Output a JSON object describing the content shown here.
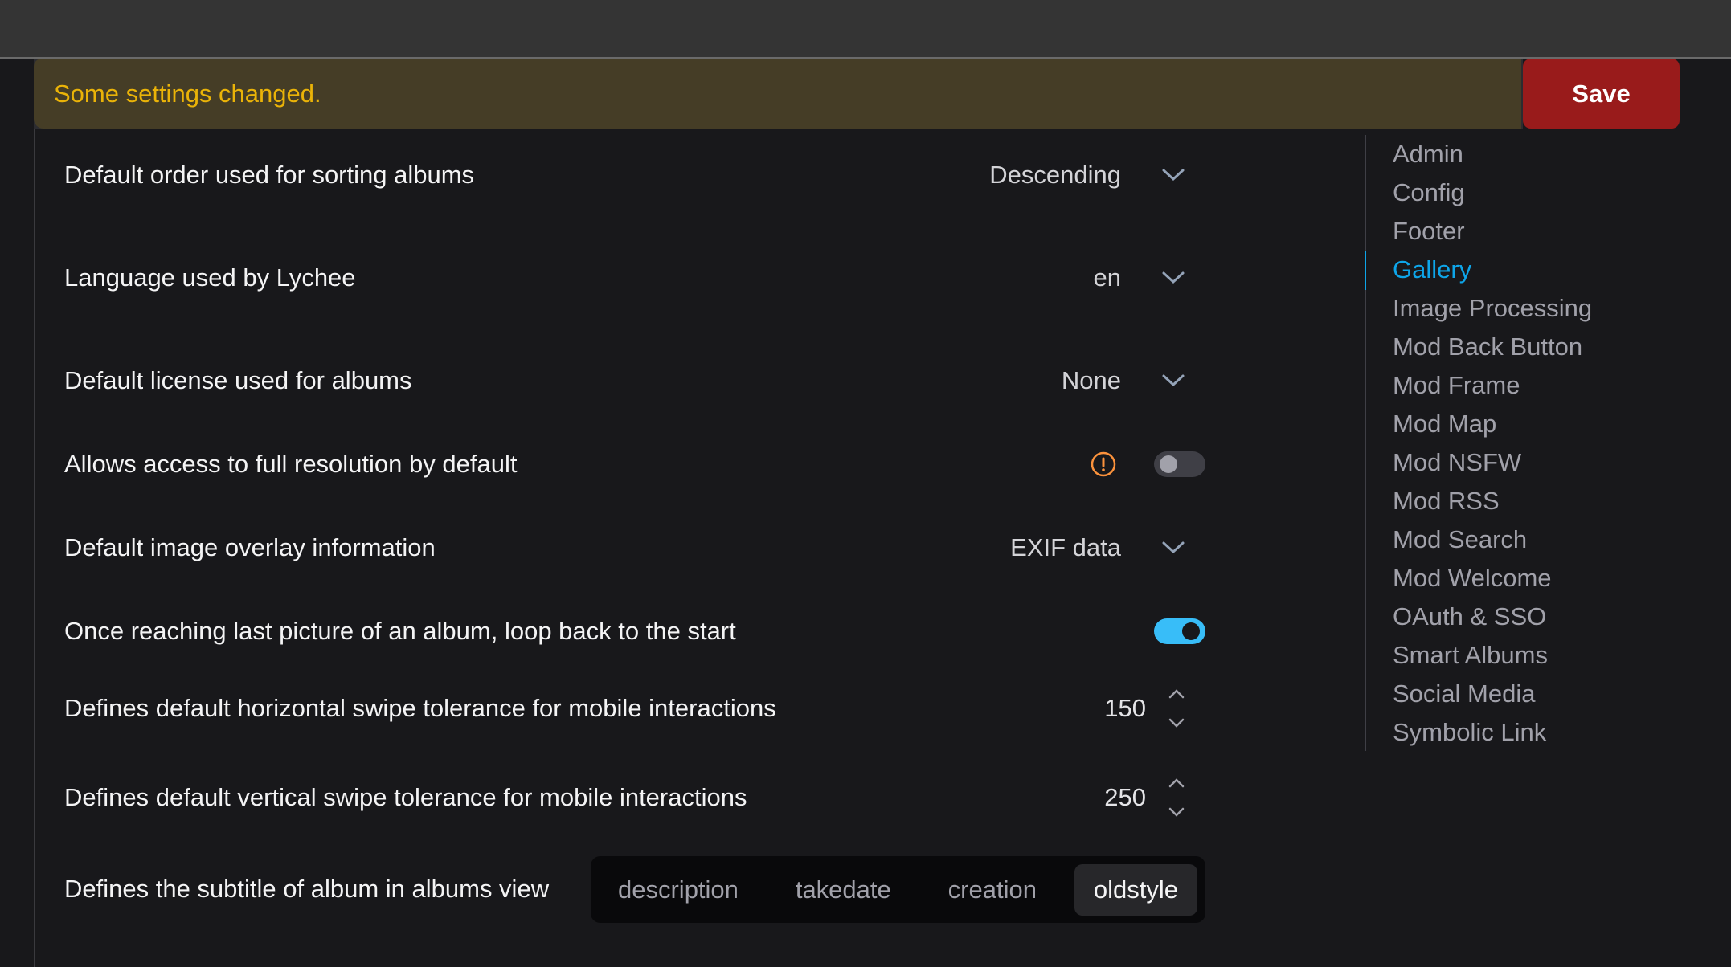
{
  "banner": {
    "message": "Some settings changed.",
    "save_label": "Save"
  },
  "settings": [
    {
      "label": "Default order used for sorting albums",
      "type": "select",
      "value": "Descending"
    },
    {
      "label": "Language used by Lychee",
      "type": "select",
      "value": "en"
    },
    {
      "label": "Default license used for albums",
      "type": "select",
      "value": "None"
    },
    {
      "label": "Allows access to full resolution by default",
      "type": "toggle",
      "value": false,
      "warning": true
    },
    {
      "label": "Default image overlay information",
      "type": "select",
      "value": "EXIF data"
    },
    {
      "label": "Once reaching last picture of an album, loop back to the start",
      "type": "toggle",
      "value": true
    },
    {
      "label": "Defines default horizontal swipe tolerance for mobile interactions",
      "type": "number",
      "value": "150"
    },
    {
      "label": "Defines default vertical swipe tolerance for mobile interactions",
      "type": "number",
      "value": "250"
    },
    {
      "label": "Defines the subtitle of album in albums view",
      "type": "segmented",
      "options": [
        "description",
        "takedate",
        "creation",
        "oldstyle"
      ],
      "selected": "oldstyle"
    }
  ],
  "sidebar": {
    "active": "Gallery",
    "items": [
      {
        "label": "Admin"
      },
      {
        "label": "Config"
      },
      {
        "label": "Footer"
      },
      {
        "label": "Gallery"
      },
      {
        "label": "Image Processing"
      },
      {
        "label": "Mod Back Button"
      },
      {
        "label": "Mod Frame"
      },
      {
        "label": "Mod Map"
      },
      {
        "label": "Mod NSFW"
      },
      {
        "label": "Mod RSS"
      },
      {
        "label": "Mod Search"
      },
      {
        "label": "Mod Welcome"
      },
      {
        "label": "OAuth & SSO"
      },
      {
        "label": "Smart Albums"
      },
      {
        "label": "Social Media"
      },
      {
        "label": "Symbolic Link"
      }
    ]
  },
  "colors": {
    "accent": "#0ea5e9",
    "toggle_on": "#38bdf8",
    "save": "#991b1b",
    "warning_banner_bg": "#453d26",
    "warning_text": "#eab308",
    "warning_icon": "#fb923c"
  }
}
